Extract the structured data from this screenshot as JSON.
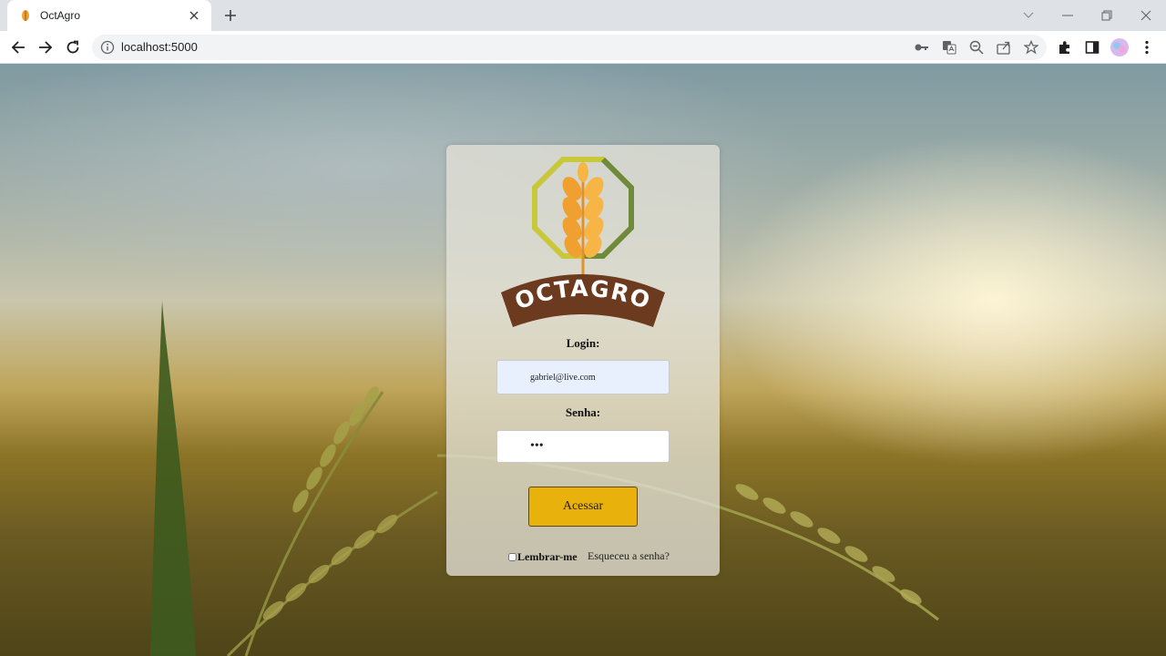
{
  "browser": {
    "tab_title": "OctAgro",
    "url": "localhost:5000"
  },
  "logo": {
    "brand_text": "OCTAGRO"
  },
  "login_form": {
    "login_label": "Login:",
    "login_value": "gabriel@live.com",
    "password_label": "Senha:",
    "password_value": "•••",
    "submit_label": "Acessar",
    "remember_label": "Lembrar-me",
    "forgot_label": "Esqueceu a senha?"
  },
  "colors": {
    "button": "#e9b10c",
    "logo_banner": "#6b3a1f",
    "logo_wheat": "#f0a030",
    "logo_octagon_light": "#c8c83a",
    "logo_octagon_dark": "#6f8a3a"
  }
}
